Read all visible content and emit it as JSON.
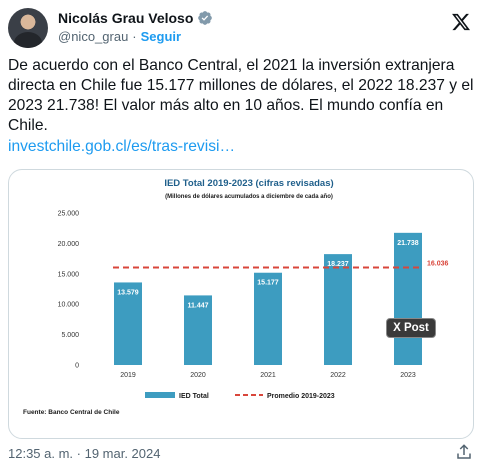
{
  "author": {
    "name": "Nicolás Grau Veloso",
    "handle": "@nico_grau",
    "separator": "·",
    "follow_label": "Seguir"
  },
  "tweet": {
    "text": "De acuerdo con el Banco Central, el 2021 la inversión extranjera directa en Chile fue 15.177 millones de dólares, el 2022 18.237 y el 2023 21.738! El valor más alto en 10 años. El mundo confía en Chile.",
    "link": "investchile.gob.cl/es/tras-revisi…",
    "timestamp": "12:35 a. m. · 19 mar. 2024"
  },
  "overlay": {
    "xpost_label": "X Post"
  },
  "colors": {
    "bar": "#3d9cc0",
    "average": "#d9463b",
    "link": "#1d9bf0",
    "title": "#1f5f8b"
  },
  "chart_data": {
    "type": "bar",
    "title": "IED Total 2019-2023 (cifras revisadas)",
    "subtitle": "(Millones de dólares acumulados a diciembre de cada año)",
    "categories": [
      "2019",
      "2020",
      "2021",
      "2022",
      "2023"
    ],
    "values": [
      13579,
      11447,
      15177,
      18237,
      21738
    ],
    "value_labels": [
      "13.579",
      "11.447",
      "15.177",
      "18.237",
      "21.738"
    ],
    "yticks": [
      0,
      5000,
      10000,
      15000,
      20000,
      25000
    ],
    "ytick_labels": [
      "0",
      "5.000",
      "10.000",
      "15.000",
      "20.000",
      "25.000"
    ],
    "ylim": [
      0,
      25000
    ],
    "average": {
      "value": 16036,
      "label": "16.036"
    },
    "legend": {
      "bar": "IED Total",
      "average": "Promedio 2019-2023",
      "position": "bottom-center"
    },
    "source": "Fuente: Banco Central de Chile",
    "grid": false
  }
}
